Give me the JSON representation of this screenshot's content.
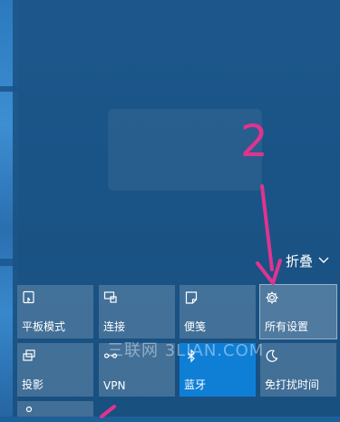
{
  "annotation_number": "2",
  "collapse": {
    "label": "折叠"
  },
  "tiles": [
    {
      "label": "平板模式",
      "icon": "tablet-mode-icon"
    },
    {
      "label": "连接",
      "icon": "connect-icon"
    },
    {
      "label": "便笺",
      "icon": "note-icon"
    },
    {
      "label": "所有设置",
      "icon": "gear-icon"
    },
    {
      "label": "投影",
      "icon": "project-icon"
    },
    {
      "label": "VPN",
      "icon": "vpn-icon"
    },
    {
      "label": "蓝牙",
      "icon": "bluetooth-icon"
    },
    {
      "label": "免打扰时间",
      "icon": "quiet-hours-icon"
    },
    {
      "label": "",
      "icon": "location-icon"
    }
  ],
  "watermark": "三联网 3LIAN.COM",
  "colors": {
    "annotation": "#e0338f",
    "active_tile": "#0f7fd6"
  }
}
